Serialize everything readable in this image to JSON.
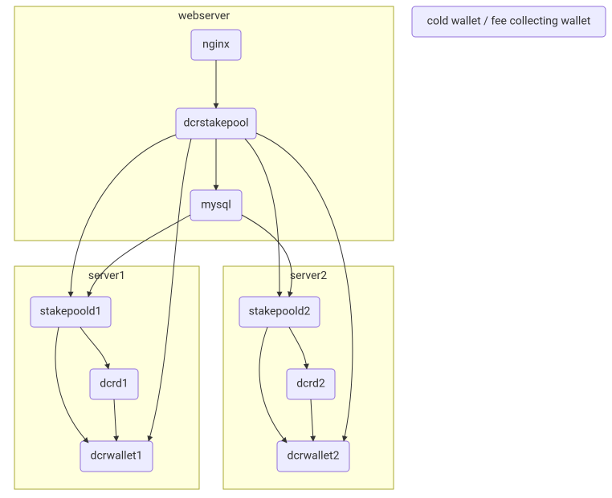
{
  "clusters": {
    "webserver": {
      "label": "webserver"
    },
    "server1": {
      "label": "server1"
    },
    "server2": {
      "label": "server2"
    }
  },
  "nodes": {
    "nginx": {
      "label": "nginx"
    },
    "dcrstakepool": {
      "label": "dcrstakepool"
    },
    "mysql": {
      "label": "mysql"
    },
    "stakepoold1": {
      "label": "stakepoold1"
    },
    "dcrd1": {
      "label": "dcrd1"
    },
    "dcrwallet1": {
      "label": "dcrwallet1"
    },
    "stakepoold2": {
      "label": "stakepoold2"
    },
    "dcrd2": {
      "label": "dcrd2"
    },
    "dcrwallet2": {
      "label": "dcrwallet2"
    },
    "coldwallet": {
      "label": "cold wallet / fee collecting wallet"
    }
  },
  "edges": [
    {
      "from": "nginx",
      "to": "dcrstakepool"
    },
    {
      "from": "dcrstakepool",
      "to": "mysql"
    },
    {
      "from": "dcrstakepool",
      "to": "stakepoold1"
    },
    {
      "from": "dcrstakepool",
      "to": "dcrwallet1"
    },
    {
      "from": "dcrstakepool",
      "to": "stakepoold2"
    },
    {
      "from": "dcrstakepool",
      "to": "dcrwallet2"
    },
    {
      "from": "mysql",
      "to": "stakepoold1"
    },
    {
      "from": "mysql",
      "to": "stakepoold2"
    },
    {
      "from": "stakepoold1",
      "to": "dcrd1"
    },
    {
      "from": "stakepoold1",
      "to": "dcrwallet1"
    },
    {
      "from": "dcrd1",
      "to": "dcrwallet1"
    },
    {
      "from": "stakepoold2",
      "to": "dcrd2"
    },
    {
      "from": "stakepoold2",
      "to": "dcrwallet2"
    },
    {
      "from": "dcrd2",
      "to": "dcrwallet2"
    }
  ]
}
